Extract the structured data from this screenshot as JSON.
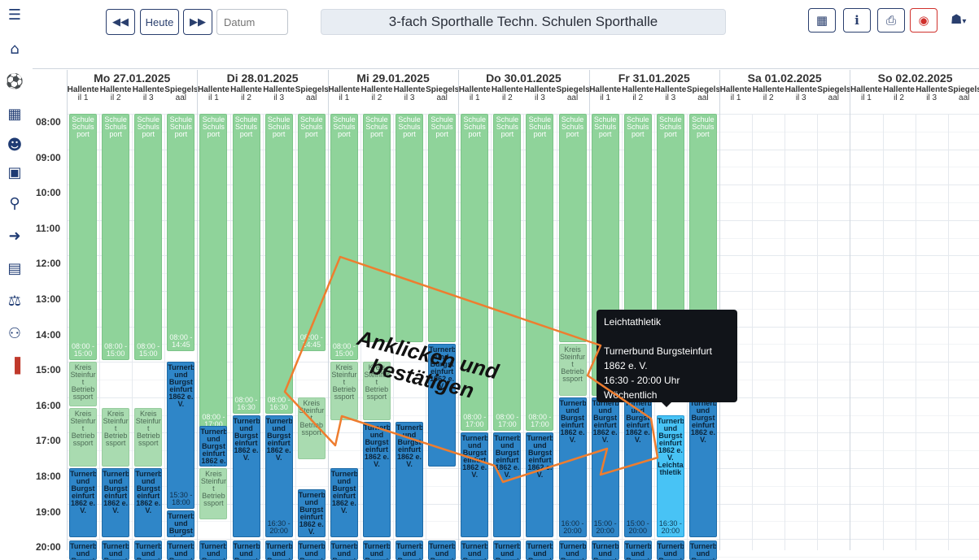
{
  "toolbar": {
    "prev_icon": "double-chevron-left-icon",
    "heute_label": "Heute",
    "next_icon": "double-chevron-right-icon",
    "datum_placeholder": "Datum",
    "venue_title": "3-fach Sporthalle Techn. Schulen Sporthalle",
    "right_buttons": [
      "calendar-icon",
      "info-icon",
      "print-icon",
      "close-icon",
      "user-icon"
    ]
  },
  "sidebar": [
    "menu-icon",
    "home-icon",
    "ball-icon",
    "building-icon",
    "group-icon",
    "calendar-check-icon",
    "search-icon",
    "login-icon",
    "id-card-icon",
    "scale-icon",
    "user-add-icon",
    "exit-icon"
  ],
  "days": [
    {
      "label": "Mo 27.01.2025"
    },
    {
      "label": "Di 28.01.2025"
    },
    {
      "label": "Mi 29.01.2025"
    },
    {
      "label": "Do 30.01.2025"
    },
    {
      "label": "Fr 31.01.2025"
    },
    {
      "label": "Sa 01.02.2025"
    },
    {
      "label": "So 02.02.2025"
    }
  ],
  "subcolumns": [
    {
      "top": "Hallente",
      "bottom": "il 1"
    },
    {
      "top": "Hallente",
      "bottom": "il 2"
    },
    {
      "top": "Hallente",
      "bottom": "il 3"
    },
    {
      "top": "Spiegels",
      "bottom": "aal"
    }
  ],
  "hours": [
    "08:00",
    "09:00",
    "10:00",
    "11:00",
    "12:00",
    "13:00",
    "14:00",
    "15:00",
    "16:00",
    "17:00",
    "18:00",
    "19:00",
    "20:00"
  ],
  "event_texts": {
    "schulsport": "Schule Schuls port",
    "kreissport": "Kreis Steinfur t Betrieb ssport",
    "turnerbund": "Turnerb und Burgst einfurt 1862 e. V.",
    "leichtathletik": "Turnerb und Burgst einfurt 1862 e. V. Leichta thletik",
    "times": {
      "t0800_1500": "08:00 - 15:00",
      "t0800_1445": "08:00 - 14:45",
      "t0800_1630": "08:00 - 16:30",
      "t0800_1700": "08:00 - 17:00",
      "t1530_1800": "15:30 - 18:00",
      "t1630_2000": "16:30 - 20:00",
      "t1500_2000": "15:00 - 20:00",
      "t1600_2000": "16:00 - 20:00"
    }
  },
  "tooltip": {
    "title": "Leichtathletik",
    "org_line1": "Turnerbund Burgsteinfurt",
    "org_line2": "1862 e. V.",
    "time": "16:30 - 20:00 Uhr",
    "recurrence": "Wöchentlich"
  },
  "hint": {
    "line1": "Anklicken und",
    "line2": "bestätigen"
  },
  "colors": {
    "school": "#8fd39a",
    "club": "#2f86c8",
    "selected": "#48c3f5",
    "annotation": "#ee7d2f"
  }
}
